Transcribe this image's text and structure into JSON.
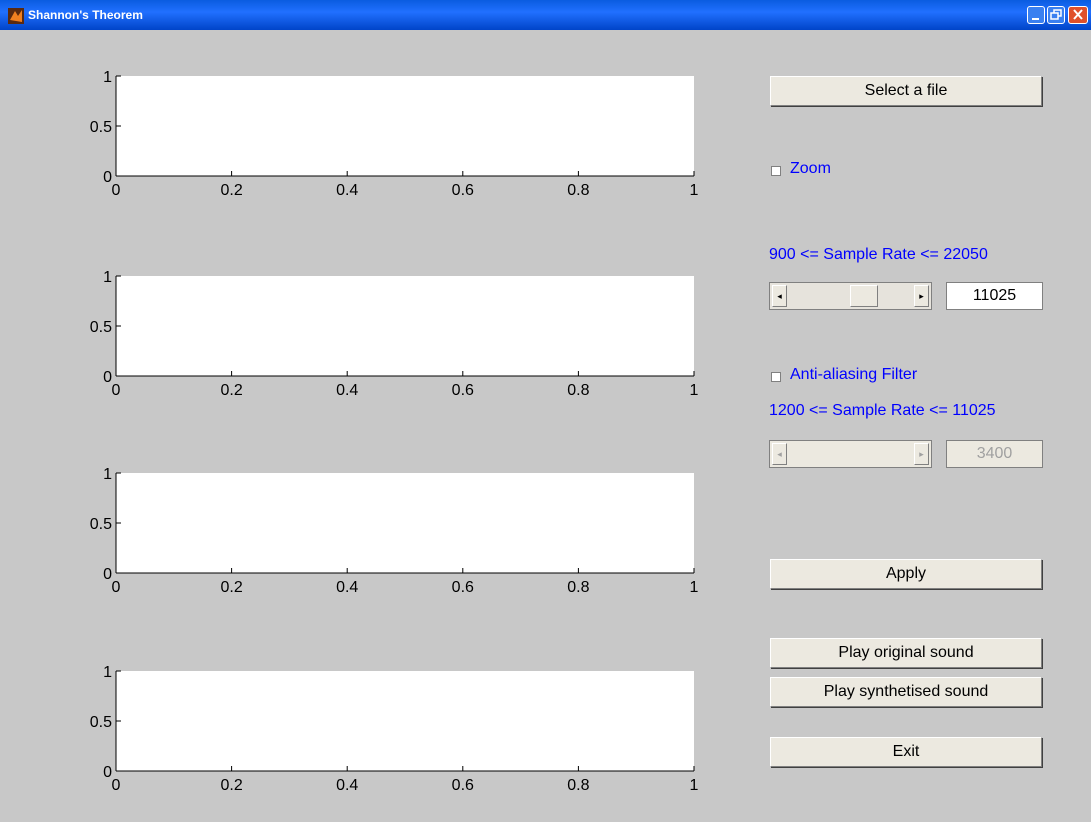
{
  "window": {
    "title": "Shannon's Theorem",
    "controls": [
      "minimize-icon",
      "restore-icon",
      "close-icon"
    ]
  },
  "axes": {
    "y_ticks": [
      "0",
      "0.5",
      "1"
    ],
    "x_ticks": [
      "0",
      "0.2",
      "0.4",
      "0.6",
      "0.8",
      "1"
    ]
  },
  "controls": {
    "select_file_label": "Select a file",
    "zoom_label": "Zoom",
    "zoom_checked": false,
    "sample_rate_range_label": "900 <= Sample Rate <= 22050",
    "sample_rate_value": "11025",
    "anti_aliasing_label": "Anti-aliasing Filter",
    "anti_aliasing_checked": false,
    "filter_rate_range_label": "1200 <= Sample Rate <= 11025",
    "filter_rate_value": "3400",
    "apply_label": "Apply",
    "play_original_label": "Play original sound",
    "play_synth_label": "Play synthetised sound",
    "exit_label": "Exit"
  },
  "colors": {
    "titlebar": "#0a5ce0",
    "label_blue": "#0000ff",
    "background": "#c8c8c8"
  }
}
